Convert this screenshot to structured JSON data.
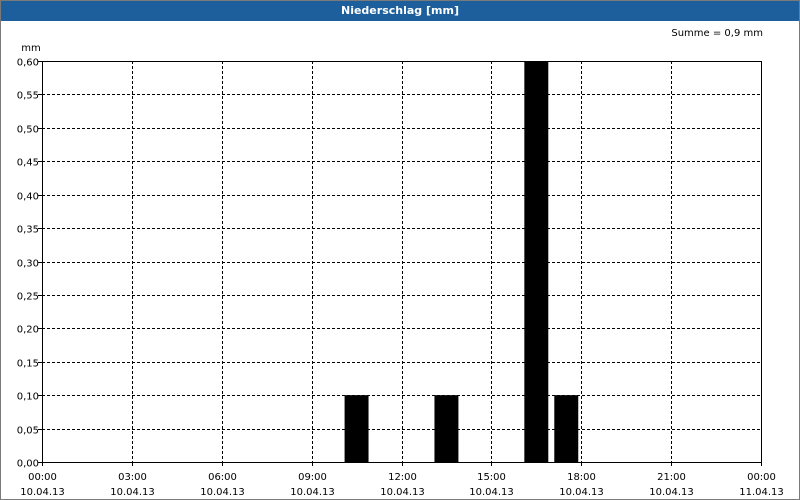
{
  "window": {
    "title": "Niederschlag [mm]"
  },
  "chart_data": {
    "type": "bar",
    "title": "Niederschlag [mm]",
    "ylabel": "mm",
    "annotation": "Summe = 0,9 mm",
    "ylim": [
      0,
      0.6
    ],
    "yticks": [
      "0,00",
      "0,05",
      "0,10",
      "0,15",
      "0,20",
      "0,25",
      "0,30",
      "0,35",
      "0,40",
      "0,45",
      "0,50",
      "0,55",
      "0,60"
    ],
    "xlim_hours": [
      0,
      24
    ],
    "xticks": [
      {
        "time": "00:00",
        "date": "10.04.13"
      },
      {
        "time": "03:00",
        "date": "10.04.13"
      },
      {
        "time": "06:00",
        "date": "10.04.13"
      },
      {
        "time": "09:00",
        "date": "10.04.13"
      },
      {
        "time": "12:00",
        "date": "10.04.13"
      },
      {
        "time": "15:00",
        "date": "10.04.13"
      },
      {
        "time": "18:00",
        "date": "10.04.13"
      },
      {
        "time": "21:00",
        "date": "10.04.13"
      },
      {
        "time": "00:00",
        "date": "11.04.13"
      }
    ],
    "grid": true,
    "bar_color": "#000000",
    "bars": [
      {
        "start_hour": 10,
        "end_hour": 11,
        "value": 0.1
      },
      {
        "start_hour": 13,
        "end_hour": 14,
        "value": 0.1
      },
      {
        "start_hour": 16,
        "end_hour": 17,
        "value": 0.6
      },
      {
        "start_hour": 17,
        "end_hour": 18,
        "value": 0.1
      }
    ]
  }
}
